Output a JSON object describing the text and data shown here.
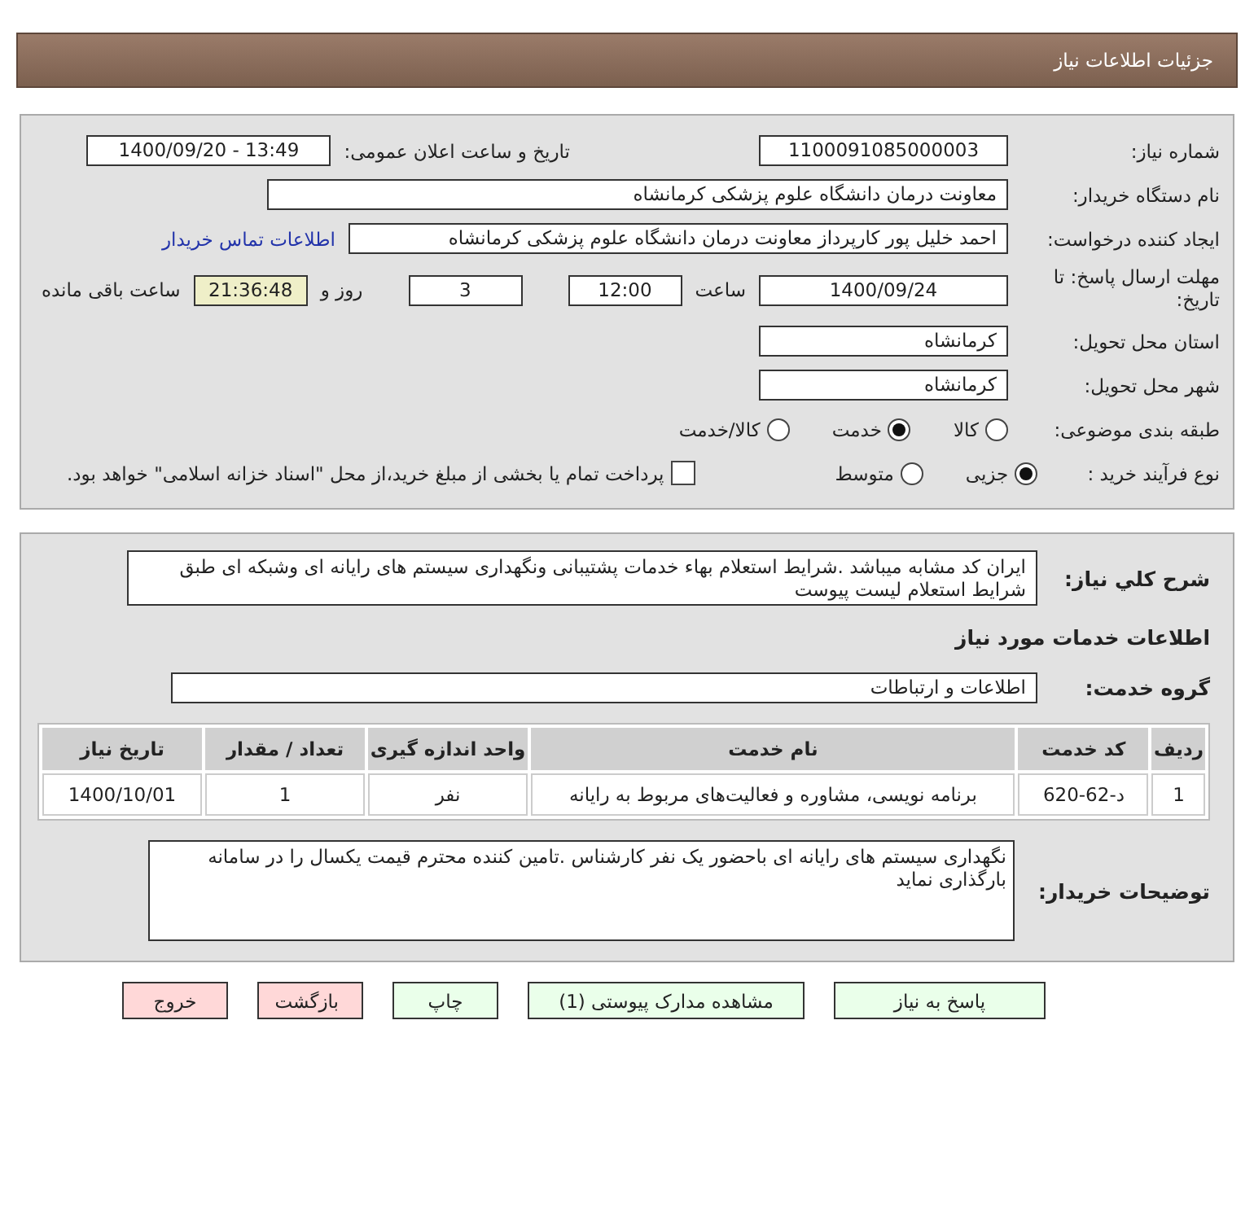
{
  "header": {
    "title": "جزئیات اطلاعات نیاز"
  },
  "details": {
    "need_number": {
      "label": "شماره نیاز:",
      "value": "1100091085000003"
    },
    "announce": {
      "label": "تاریخ و ساعت اعلان عمومی:",
      "value": "1400/09/20 - 13:49"
    },
    "buyer_org": {
      "label": "نام دستگاه خریدار:",
      "value": "معاونت درمان دانشگاه علوم پزشکی کرمانشاه"
    },
    "requester": {
      "label": "ایجاد کننده درخواست:",
      "value": "احمد خلیل پور کارپرداز معاونت درمان دانشگاه علوم پزشکی کرمانشاه",
      "link": "اطلاعات تماس خریدار"
    },
    "deadline": {
      "label": "مهلت ارسال پاسخ: تا تاریخ:",
      "date": "1400/09/24",
      "time_label": "ساعت",
      "time": "12:00",
      "days": "3",
      "days_label": "روز و",
      "remaining": "21:36:48",
      "remaining_label": "ساعت باقی مانده"
    },
    "province": {
      "label": "استان محل تحویل:",
      "value": "کرمانشاه"
    },
    "city": {
      "label": "شهر محل تحویل:",
      "value": "کرمانشاه"
    },
    "category": {
      "label": "طبقه بندی موضوعی:",
      "options": [
        {
          "label": "کالا",
          "selected": false
        },
        {
          "label": "خدمت",
          "selected": true
        },
        {
          "label": "کالا/خدمت",
          "selected": false
        }
      ]
    },
    "process": {
      "label": "نوع فرآیند خرید :",
      "options": [
        {
          "label": "جزیی",
          "selected": true
        },
        {
          "label": "متوسط",
          "selected": false
        }
      ],
      "payment": {
        "label": "پرداخت تمام یا بخشی از مبلغ خرید،از محل \"اسناد خزانه اسلامی\" خواهد بود.",
        "checked": false
      }
    }
  },
  "services": {
    "description": {
      "label": "شرح کلي نياز:",
      "value": "ایران کد مشابه میباشد .شرایط استعلام بهاء خدمات پشتیبانی ونگهداری سیستم های رایانه ای وشبکه ای طبق شرایط استعلام لیست پیوست"
    },
    "section_title": "اطلاعات خدمات مورد نیاز",
    "group": {
      "label": "گروه خدمت:",
      "value": "اطلاعات و ارتباطات"
    },
    "table": {
      "columns": [
        "ردیف",
        "کد خدمت",
        "نام خدمت",
        "واحد اندازه گیری",
        "تعداد / مقدار",
        "تاریخ نیاز"
      ],
      "rows": [
        [
          "1",
          "د-62-620",
          "برنامه نویسی، مشاوره و فعالیت‌های مربوط به رایانه",
          "نفر",
          "1",
          "1400/10/01"
        ]
      ]
    },
    "notes": {
      "label": "توضیحات خریدار:",
      "value": "نگهداری سیستم های رایانه ای باحضور یک نفر کارشناس .تامین کننده محترم قیمت یکسال را در سامانه بارگذاری نماید"
    }
  },
  "buttons": [
    {
      "label": "پاسخ به نیاز",
      "kind": "go"
    },
    {
      "label": "مشاهده مدارک پیوستی (1)",
      "kind": "go"
    },
    {
      "label": "چاپ",
      "kind": "go"
    },
    {
      "label": "بازگشت",
      "kind": "stop"
    },
    {
      "label": "خروج",
      "kind": "stop"
    }
  ]
}
